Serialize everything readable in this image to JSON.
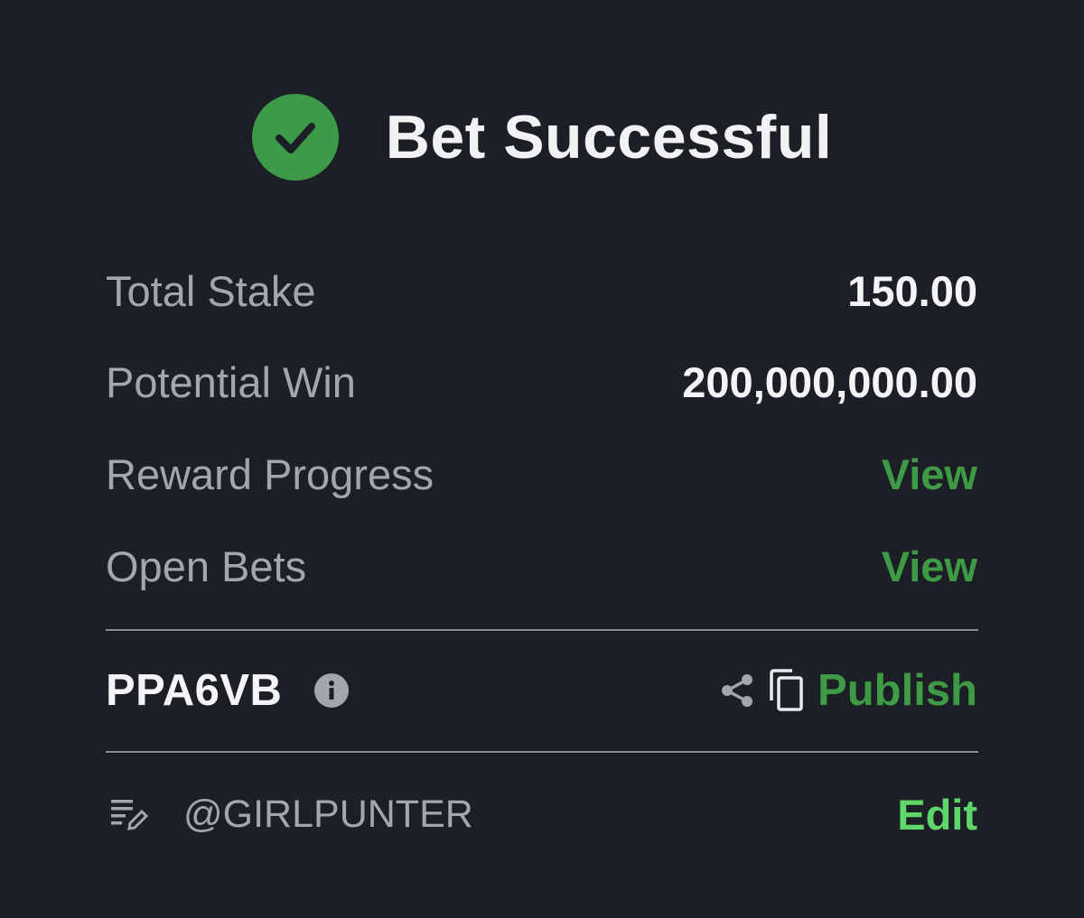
{
  "header": {
    "title": "Bet Successful",
    "status_icon": "check-circle-icon",
    "status_color": "#3d9b48"
  },
  "summary": {
    "total_stake_label": "Total Stake",
    "total_stake_value": "150.00",
    "potential_win_label": "Potential Win",
    "potential_win_value": "200,000,000.00",
    "reward_progress_label": "Reward Progress",
    "reward_progress_link": "View",
    "open_bets_label": "Open Bets",
    "open_bets_link": "View"
  },
  "booking": {
    "code": "PPA6VB",
    "info_icon": "info-icon",
    "share_icon": "share-icon",
    "copy_icon": "copy-icon",
    "publish_label": "Publish"
  },
  "user": {
    "note_icon": "edit-list-icon",
    "handle": "@GIRLPUNTER",
    "edit_label": "Edit"
  },
  "colors": {
    "background": "#1c1f26",
    "accent_green": "#3f9a46",
    "edit_green": "#5ed66a",
    "muted_text": "#a3a6ad",
    "primary_text": "#f4f4f6"
  }
}
